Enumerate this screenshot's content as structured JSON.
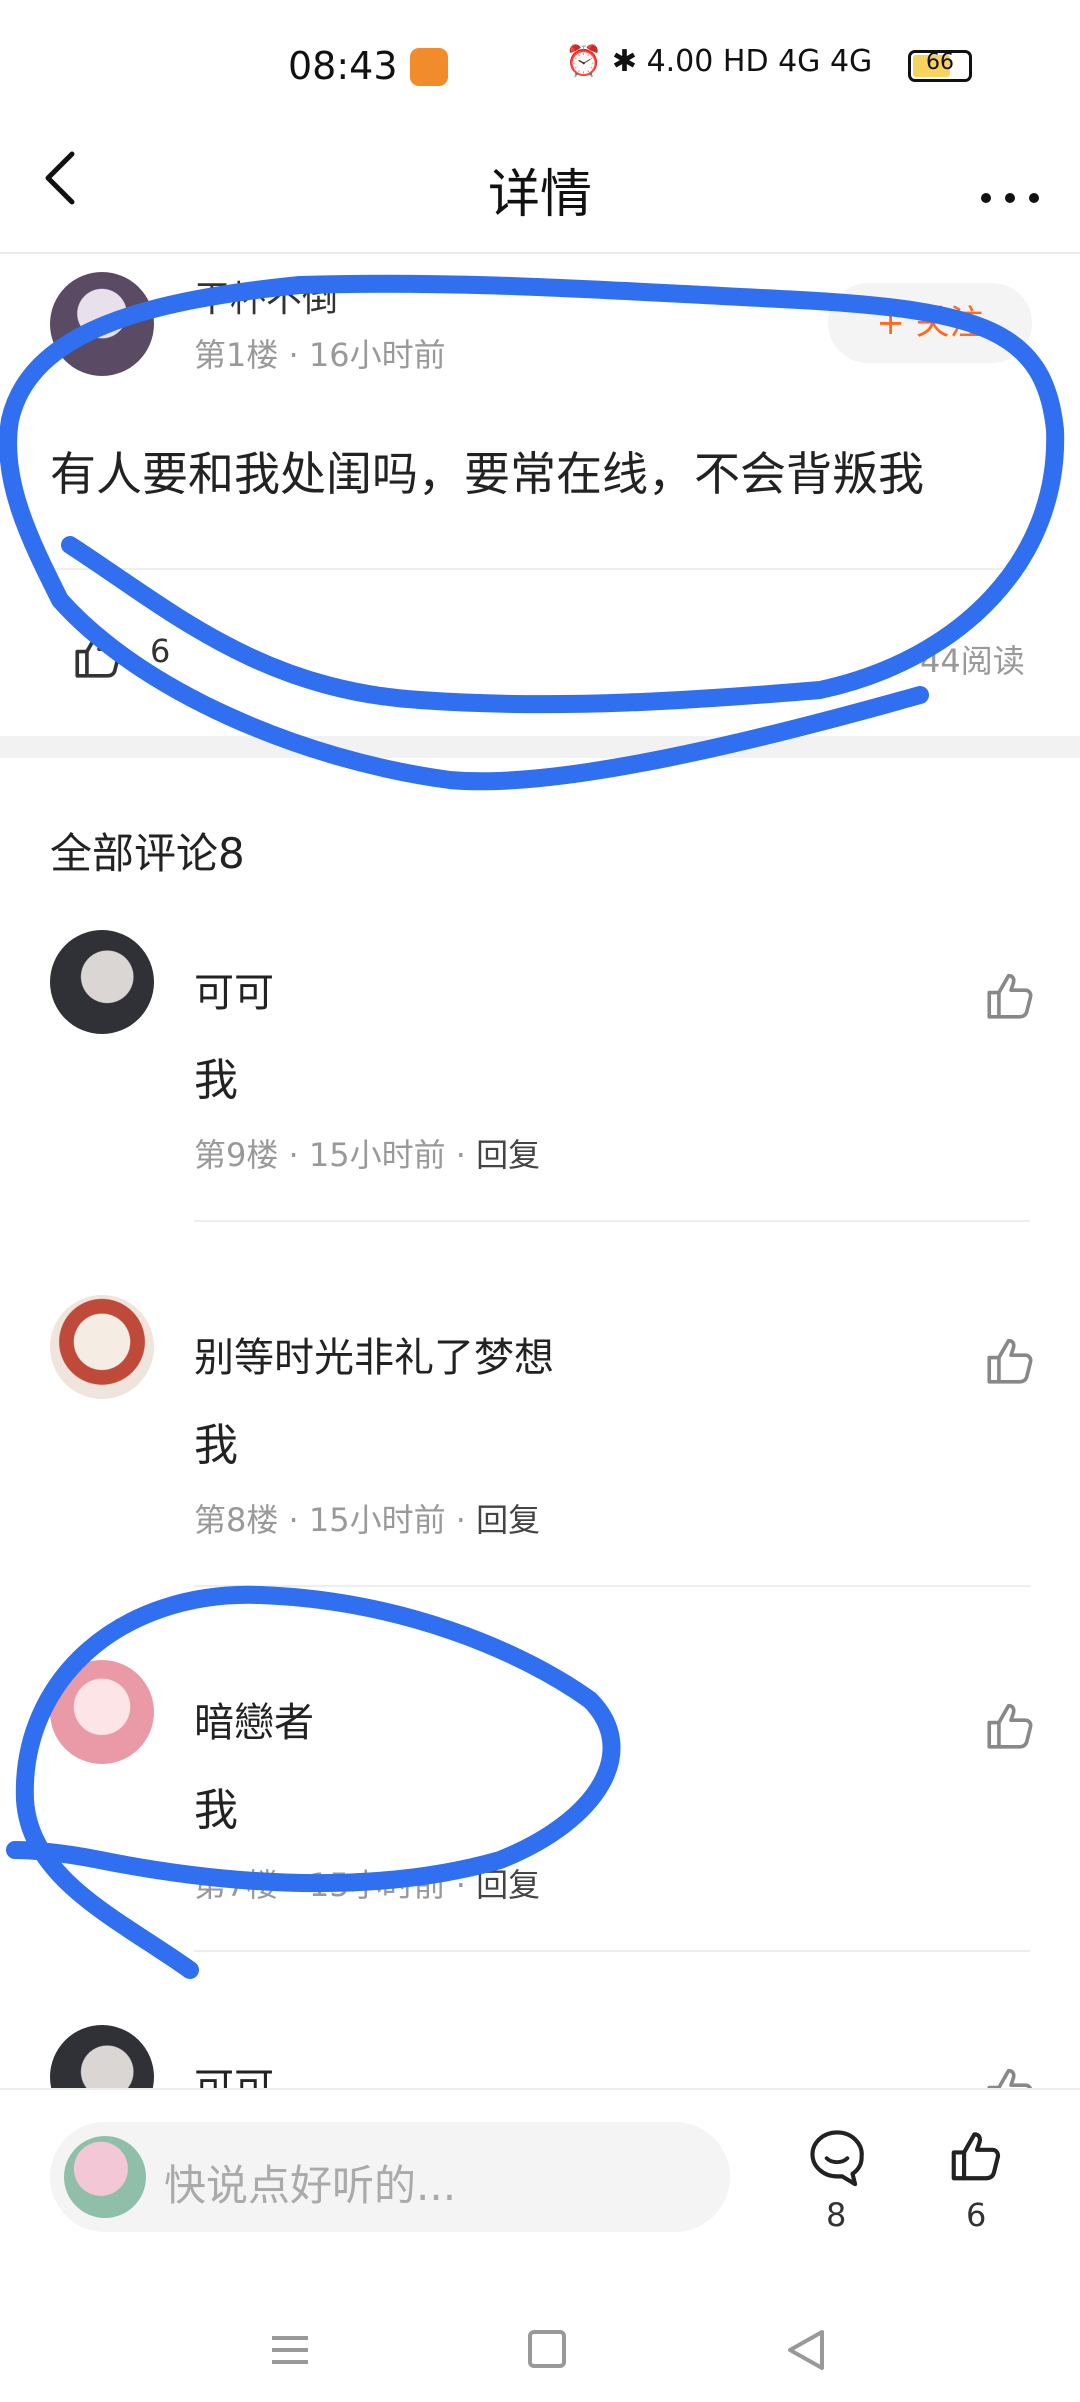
{
  "status_bar": {
    "time": "08:43",
    "icons": "⏰ ✱ 4.00 HD 4G 4G",
    "battery_level": "66",
    "battery_fill_color": "#f6d35f"
  },
  "nav": {
    "back_icon": "chevron-left-icon",
    "title": "详情",
    "more_icon": "more-icon"
  },
  "post": {
    "author": "干杯不倒",
    "meta": "第1楼 · 16小时前",
    "follow_label": "+ 关注",
    "content": "有人要和我处闺吗，要常在线，不会背叛我",
    "like_count": "6",
    "reads": "44阅读"
  },
  "comments_section": {
    "title": "全部评论8",
    "reply_label": "回复",
    "items": [
      {
        "name": "可可",
        "text": "我",
        "meta": "第9楼 · 15小时前 · "
      },
      {
        "name": "别等时光非礼了梦想",
        "text": "我",
        "meta": "第8楼 · 15小时前 · "
      },
      {
        "name": "暗戀者",
        "text": "我",
        "meta": "第7楼 · 15小时前 · "
      },
      {
        "name": "可可",
        "text": "",
        "meta": ""
      }
    ]
  },
  "bottom_bar": {
    "placeholder": "快说点好听的...",
    "comment_count": "8",
    "like_count": "6"
  },
  "colors": {
    "accent": "#ff6a1f",
    "scribble": "#2f6ff0",
    "muted_text": "#999999"
  }
}
